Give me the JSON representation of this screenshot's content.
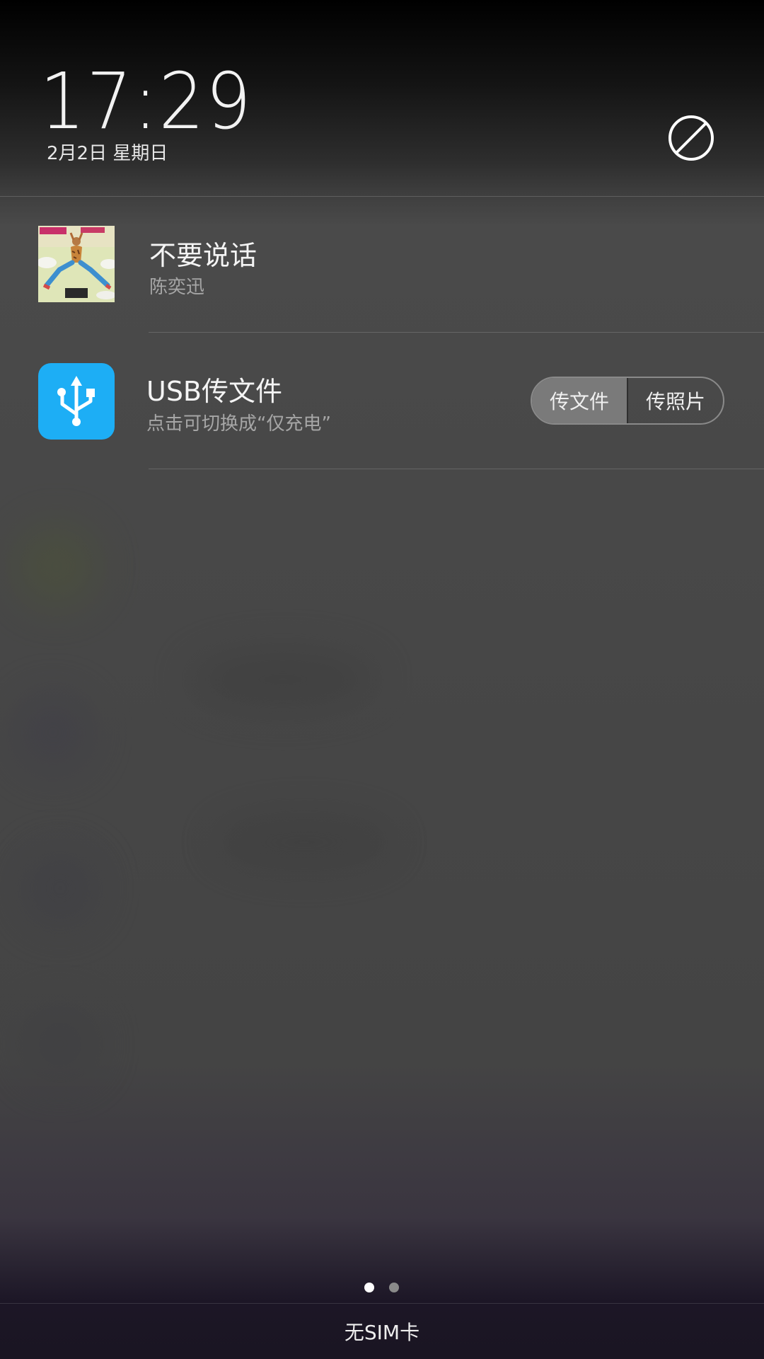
{
  "lockscreen": {
    "time": "17:29",
    "date": "2月2日 星期日"
  },
  "icons": {
    "dnd": "do-not-disturb-icon",
    "usb": "usb-icon",
    "album": "album-cover-image"
  },
  "colors": {
    "usb_icon_bg": "#1daef5",
    "segment_active_bg": "#7a7a7a"
  },
  "notifications": [
    {
      "title": "不要说话",
      "subtitle": "陈奕迅"
    },
    {
      "title": "USB传文件",
      "subtitle": "点击可切换成“仅充电”",
      "options": [
        {
          "label": "传文件",
          "selected": true
        },
        {
          "label": "传照片",
          "selected": false
        }
      ]
    }
  ],
  "pager": {
    "pages": 2,
    "current": 1
  },
  "footer": {
    "sim_status": "无SIM卡"
  }
}
